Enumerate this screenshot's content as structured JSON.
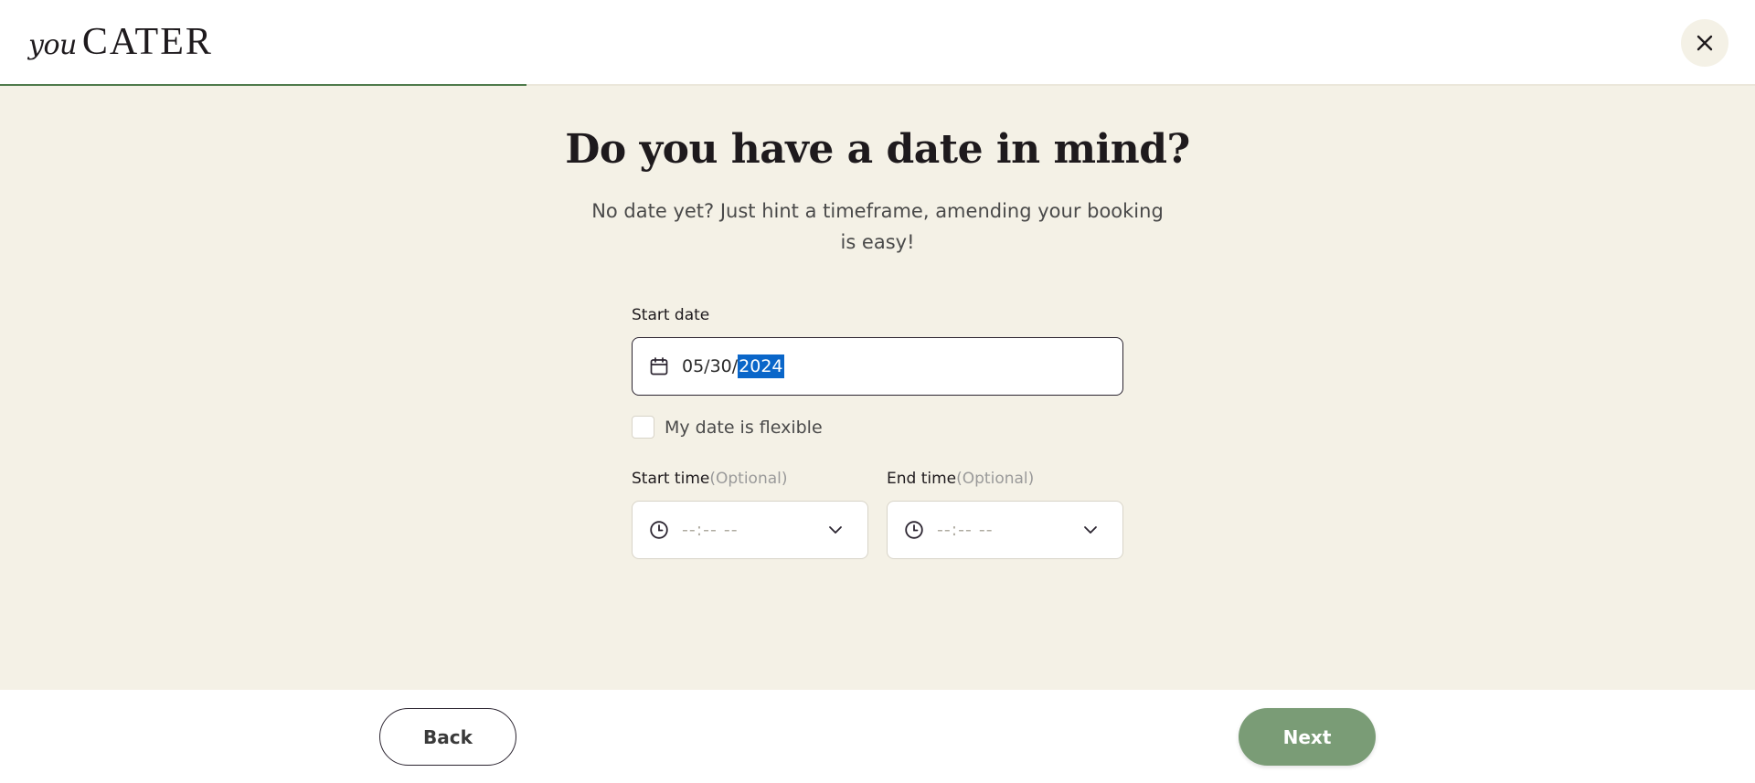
{
  "header": {
    "logo_you": "you",
    "logo_cater": "CATER",
    "close_icon": "close-icon",
    "progress_percent": 30
  },
  "main": {
    "title": "Do you have a date in mind?",
    "subtitle": "No date yet? Just hint a timeframe, amending your booking is easy!",
    "start_date": {
      "label": "Start date",
      "icon": "calendar-icon",
      "value_unselected": "05/30/",
      "value_selected": "2024"
    },
    "flexible": {
      "label": "My date is flexible",
      "checked": false
    },
    "start_time": {
      "label": "Start time",
      "optional": "(Optional)",
      "icon": "clock-icon",
      "placeholder": "--:-- --"
    },
    "end_time": {
      "label": "End time",
      "optional": "(Optional)",
      "icon": "clock-icon",
      "placeholder": "--:-- --"
    }
  },
  "footer": {
    "back_label": "Back",
    "next_label": "Next"
  },
  "colors": {
    "background": "#f4f1e6",
    "accent_green": "#7a9c76",
    "progress_green": "#4f7a4b",
    "text_dark": "#1e1a1d",
    "selection_blue": "#0a66c9"
  }
}
